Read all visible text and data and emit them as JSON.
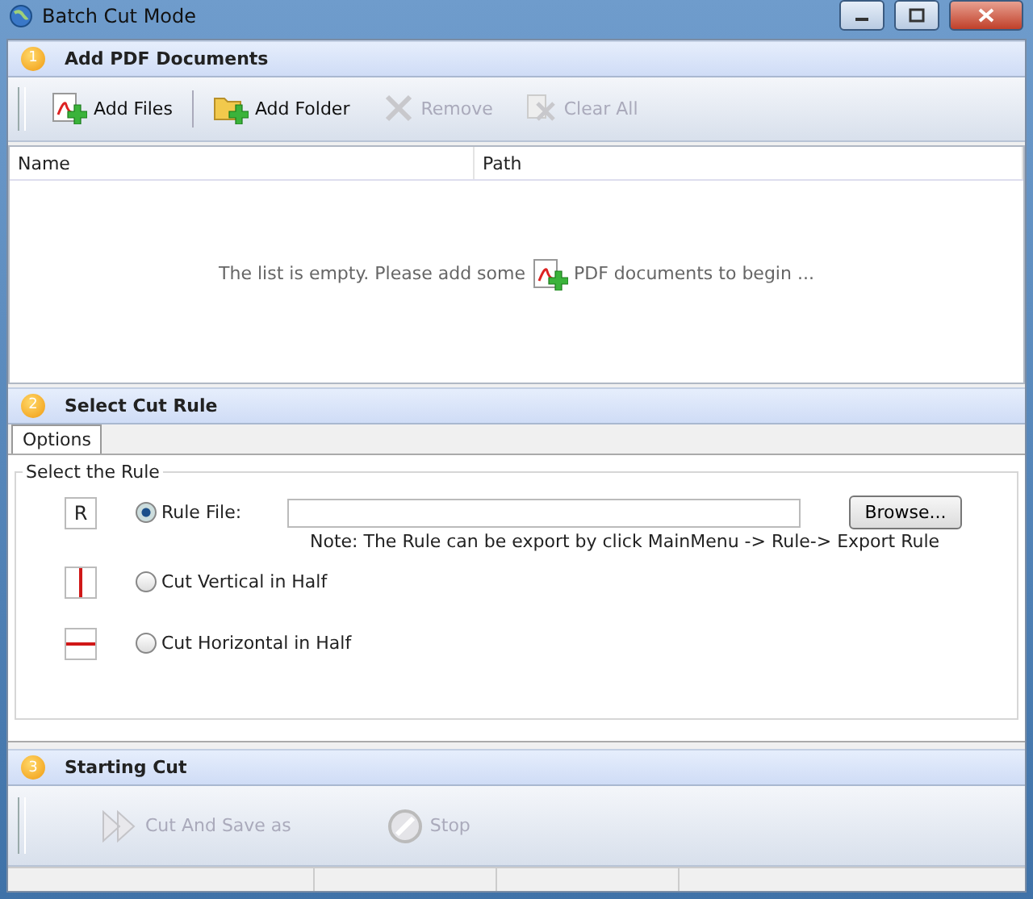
{
  "window": {
    "title": "Batch Cut Mode"
  },
  "sections": [
    {
      "number": "1",
      "title": "Add PDF Documents"
    },
    {
      "number": "2",
      "title": "Select Cut Rule"
    },
    {
      "number": "3",
      "title": "Starting Cut"
    }
  ],
  "toolbar": [
    {
      "label": "Add Files",
      "disabled": false
    },
    {
      "label": "Add Folder",
      "disabled": false
    },
    {
      "label": "Remove",
      "disabled": true
    },
    {
      "label": "Clear All",
      "disabled": true
    }
  ],
  "table": {
    "columns": [
      "Name",
      "Path"
    ],
    "empty_before": "The list is empty. Please add some",
    "empty_after": "PDF documents to begin ..."
  },
  "tabs": [
    {
      "label": "Options",
      "selected": true
    }
  ],
  "group": {
    "title": "Select the Rule"
  },
  "rules": [
    {
      "kind": "file",
      "icon_text": "R",
      "label": "Rule File:",
      "selected": true,
      "browse": "Browse...",
      "note": "Note: The Rule can be export by click MainMenu -> Rule-> Export Rule"
    },
    {
      "kind": "vertical",
      "label": "Cut Vertical in Half",
      "selected": false
    },
    {
      "kind": "horizontal",
      "label": "Cut Horizontal in Half",
      "selected": false
    }
  ],
  "actions": [
    {
      "label": "Cut And Save as",
      "disabled": true
    },
    {
      "label": "Stop",
      "disabled": true
    }
  ]
}
